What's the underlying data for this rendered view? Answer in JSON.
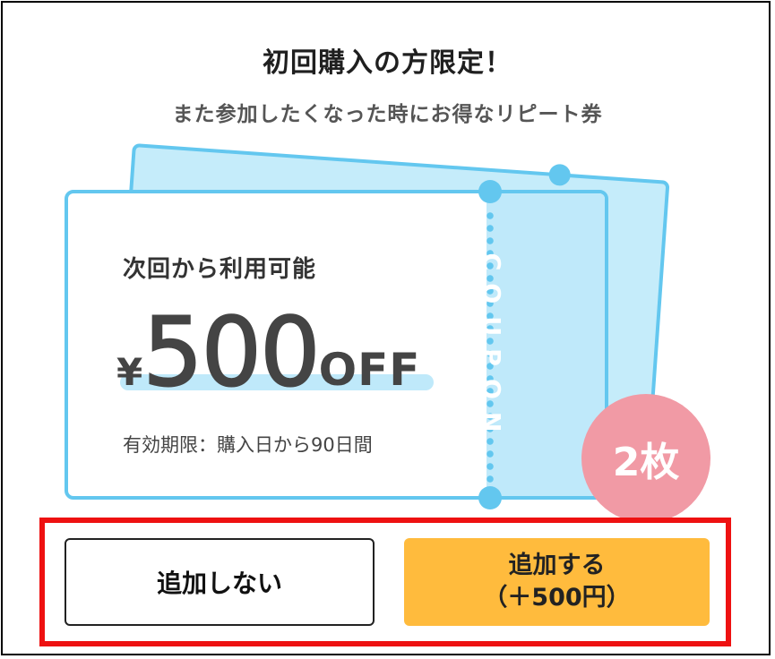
{
  "dialog": {
    "title": "初回購入の方限定！",
    "subtitle": "また参加したくなった時にお得なリピート券"
  },
  "coupon": {
    "availability": "次回から利用可能",
    "currency_symbol": "¥",
    "amount": "500",
    "off_label": "OFF",
    "validity": "有効期限：購入日から90日間",
    "stub_label": "COUPON",
    "quantity_badge": "2枚"
  },
  "actions": {
    "decline_label": "追加しない",
    "accept_label_line1": "追加する",
    "accept_label_line2": "（＋500円）"
  },
  "colors": {
    "ticket_border": "#63c7ef",
    "ticket_stub": "#bfe9fa",
    "badge": "#f19aa5",
    "accept_button": "#ffbb3d",
    "highlight_box": "#ee1111"
  }
}
